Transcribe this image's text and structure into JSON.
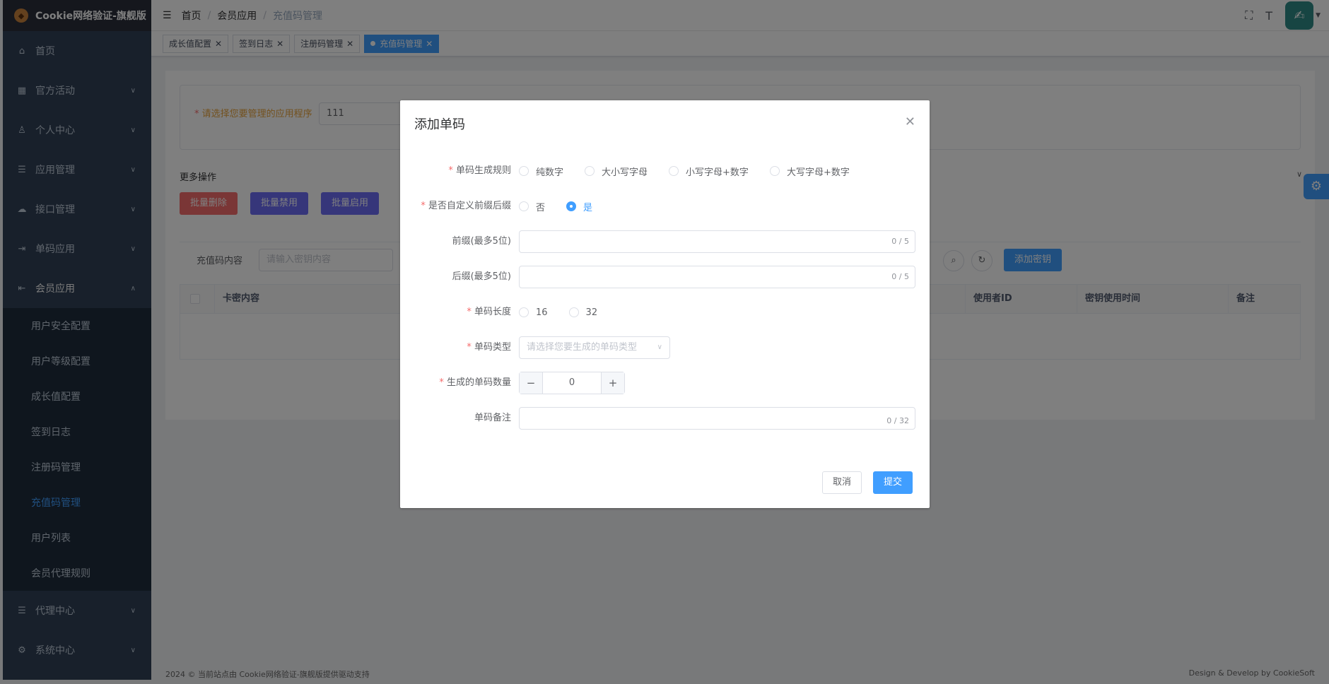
{
  "sidebar": {
    "logo": "Cookie网络验证-旗舰版",
    "items": [
      {
        "label": "首页"
      },
      {
        "label": "官方活动"
      },
      {
        "label": "个人中心"
      },
      {
        "label": "应用管理"
      },
      {
        "label": "接口管理"
      },
      {
        "label": "单码应用"
      },
      {
        "label": "会员应用"
      },
      {
        "label": "代理中心"
      },
      {
        "label": "系统中心"
      }
    ],
    "sub_items": [
      {
        "label": "用户安全配置"
      },
      {
        "label": "用户等级配置"
      },
      {
        "label": "成长值配置"
      },
      {
        "label": "签到日志"
      },
      {
        "label": "注册码管理"
      },
      {
        "label": "充值码管理"
      },
      {
        "label": "用户列表"
      },
      {
        "label": "会员代理规则"
      }
    ]
  },
  "header": {
    "breadcrumb": [
      "首页",
      "会员应用",
      "充值码管理"
    ]
  },
  "tags": [
    "成长值配置",
    "签到日志",
    "注册码管理",
    "充值码管理"
  ],
  "page": {
    "app_label": "请选择您要管理的应用程序",
    "app_value": "111",
    "more_ops": "更多操作",
    "btn_batch_delete": "批量删除",
    "btn_batch_disable": "批量禁用",
    "btn_batch_enable": "批量启用",
    "search_label": "充值码内容",
    "search_placeholder": "请输入密钥内容",
    "btn_add_key": "添加密钥",
    "table_headers": [
      "卡密内容",
      "使用者ID",
      "密钥使用时间",
      "备注"
    ]
  },
  "footer": {
    "left": "2024 © 当前站点由 Cookie网络验证-旗舰版提供驱动支持",
    "right": "Design & Develop by CookieSoft"
  },
  "dialog": {
    "title": "添加单码",
    "rule_label": "单码生成规则",
    "rule_options": [
      "纯数字",
      "大小写字母",
      "小写字母+数字",
      "大写字母+数字"
    ],
    "custom_label": "是否自定义前缀后缀",
    "custom_options": [
      "否",
      "是"
    ],
    "custom_selected": "是",
    "prefix_label": "前缀(最多5位)",
    "prefix_count": "0 / 5",
    "suffix_label": "后缀(最多5位)",
    "suffix_count": "0 / 5",
    "length_label": "单码长度",
    "length_options": [
      "16",
      "32"
    ],
    "type_label": "单码类型",
    "type_placeholder": "请选择您要生成的单码类型",
    "quantity_label": "生成的单码数量",
    "quantity_value": "0",
    "note_label": "单码备注",
    "note_count": "0 / 32",
    "cancel_label": "取消",
    "submit_label": "提交"
  }
}
